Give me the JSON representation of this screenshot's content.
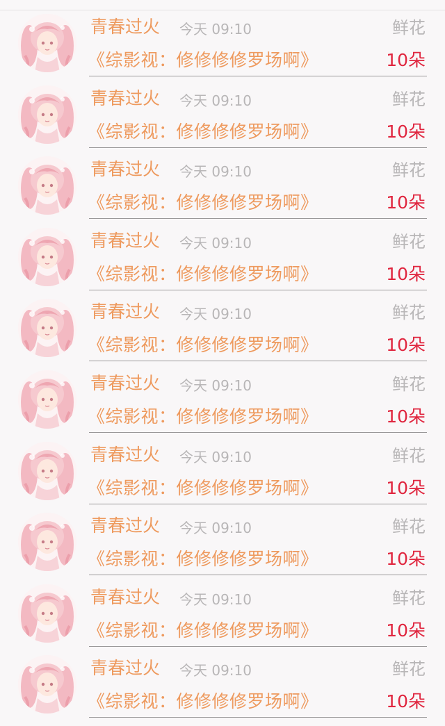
{
  "colors": {
    "name": "#ee9a5e",
    "title": "#ee9a5e",
    "count": "#e0263f",
    "muted": "#b8b6b7",
    "background": "#f9f7f8"
  },
  "avatar_icon": "anime-girl-avatar",
  "entries": [
    {
      "name": "青春过火",
      "time": "今天 09:10",
      "gift_type": "鲜花",
      "book_title": "《综影视：修修修修罗场啊》",
      "gift_count": "10朵"
    },
    {
      "name": "青春过火",
      "time": "今天 09:10",
      "gift_type": "鲜花",
      "book_title": "《综影视：修修修修罗场啊》",
      "gift_count": "10朵"
    },
    {
      "name": "青春过火",
      "time": "今天 09:10",
      "gift_type": "鲜花",
      "book_title": "《综影视：修修修修罗场啊》",
      "gift_count": "10朵"
    },
    {
      "name": "青春过火",
      "time": "今天 09:10",
      "gift_type": "鲜花",
      "book_title": "《综影视：修修修修罗场啊》",
      "gift_count": "10朵"
    },
    {
      "name": "青春过火",
      "time": "今天 09:10",
      "gift_type": "鲜花",
      "book_title": "《综影视：修修修修罗场啊》",
      "gift_count": "10朵"
    },
    {
      "name": "青春过火",
      "time": "今天 09:10",
      "gift_type": "鲜花",
      "book_title": "《综影视：修修修修罗场啊》",
      "gift_count": "10朵"
    },
    {
      "name": "青春过火",
      "time": "今天 09:10",
      "gift_type": "鲜花",
      "book_title": "《综影视：修修修修罗场啊》",
      "gift_count": "10朵"
    },
    {
      "name": "青春过火",
      "time": "今天 09:10",
      "gift_type": "鲜花",
      "book_title": "《综影视：修修修修罗场啊》",
      "gift_count": "10朵"
    },
    {
      "name": "青春过火",
      "time": "今天 09:10",
      "gift_type": "鲜花",
      "book_title": "《综影视：修修修修罗场啊》",
      "gift_count": "10朵"
    },
    {
      "name": "青春过火",
      "time": "今天 09:10",
      "gift_type": "鲜花",
      "book_title": "《综影视：修修修修罗场啊》",
      "gift_count": "10朵"
    }
  ]
}
